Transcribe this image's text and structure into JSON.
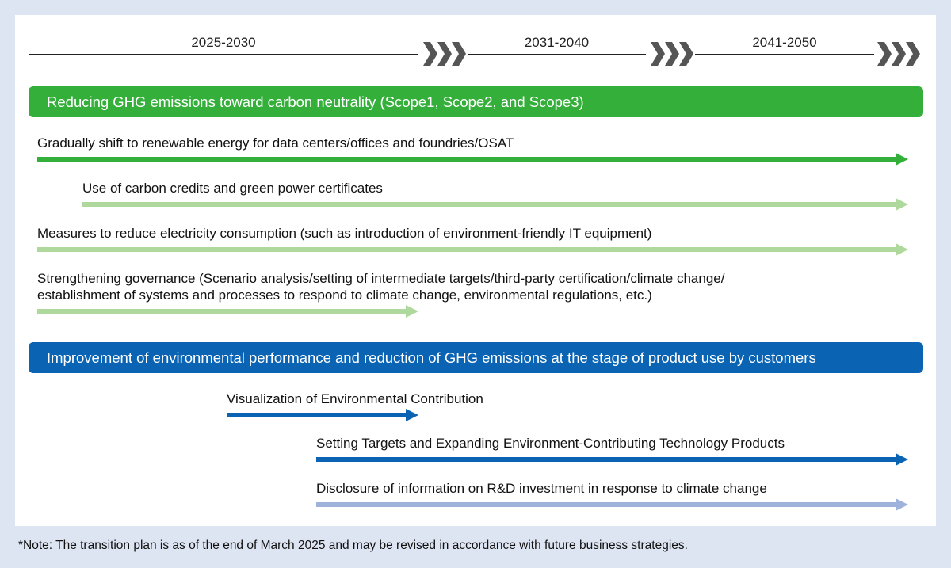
{
  "timeline": {
    "periods": [
      "2025-2030",
      "2031-2040",
      "2041-2050"
    ]
  },
  "sections": [
    {
      "title": "Reducing GHG emissions toward carbon neutrality (Scope1, Scope2, and Scope3)",
      "color": "#34af3a",
      "items": [
        {
          "label": "Gradually shift to renewable energy for data centers/offices and foundries/OSAT",
          "start": "2025-2030",
          "end": "2041-2050",
          "color": "#34af3a"
        },
        {
          "label": "Use of carbon credits and green power certificates",
          "start": "2025-2030",
          "end": "2041-2050",
          "color": "#aed89c"
        },
        {
          "label": "Measures to reduce electricity consumption (such as introduction of environment-friendly IT equipment)",
          "start": "2025-2030",
          "end": "2041-2050",
          "color": "#aed89c"
        },
        {
          "label_line1": "Strengthening governance (Scenario analysis/setting of intermediate targets/third-party certification/climate change/",
          "label_line2": "establishment of systems and processes to respond to climate change, environmental regulations, etc.)",
          "start": "2025-2030",
          "end": "2025-2030",
          "color": "#aed89c"
        }
      ]
    },
    {
      "title": "Improvement of environmental performance and reduction of GHG emissions at the stage of product use by customers",
      "color": "#0a63b3",
      "items": [
        {
          "label": "Visualization of Environmental Contribution",
          "start": "2025-2030",
          "end": "2025-2030",
          "color": "#0a63b3"
        },
        {
          "label": "Setting Targets and Expanding Environment-Contributing Technology Products",
          "start": "2025-2030",
          "end": "2041-2050",
          "color": "#0a63b3"
        },
        {
          "label": "Disclosure of information on R&D investment in response to climate change",
          "start": "2025-2030",
          "end": "2041-2050",
          "color": "#9eb2dc"
        }
      ]
    }
  ],
  "footnote": "*Note: The transition plan is as of the end of March 2025 and may be revised in accordance with future business strategies."
}
